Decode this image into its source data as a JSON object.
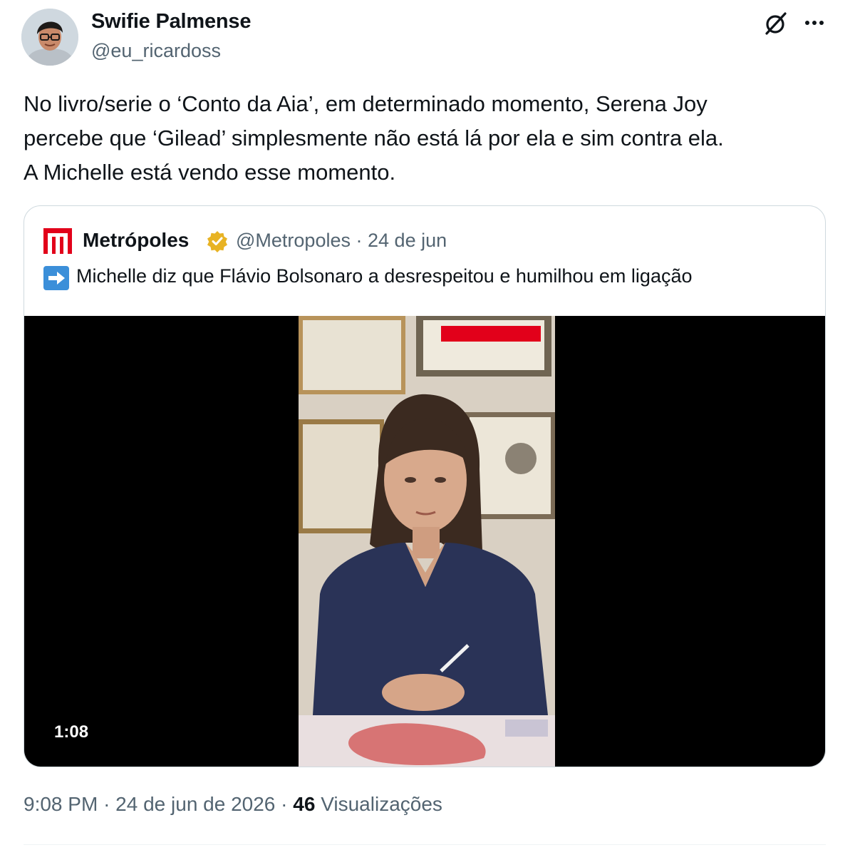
{
  "author": {
    "display_name": "Swifie Palmense",
    "handle": "@eu_ricardoss"
  },
  "icons": {
    "grok": "grok-icon",
    "more": "more-horizontal-icon",
    "verified": "verified-badge-icon",
    "arrow": "arrow-right-emoji-icon"
  },
  "tweet": {
    "lines": [
      "No livro/serie o ‘Conto da Aia’, em determinado momento,  Serena Joy",
      "percebe que ‘Gilead’ simplesmente não está lá por ela e sim contra ela.",
      "A Michelle está vendo esse momento."
    ]
  },
  "quote": {
    "name": "Metrópoles",
    "handle": "@Metropoles",
    "separator": "·",
    "date": "24 de jun",
    "text": "Michelle diz que Flávio Bolsonaro a desrespeitou e humilhou em ligação",
    "brand_color": "#e2001a",
    "video_duration": "1:08"
  },
  "meta": {
    "time": "9:08 PM",
    "separator": "·",
    "date": "24 de jun de 2026",
    "views_count": "46",
    "views_label": "Visualizações"
  }
}
